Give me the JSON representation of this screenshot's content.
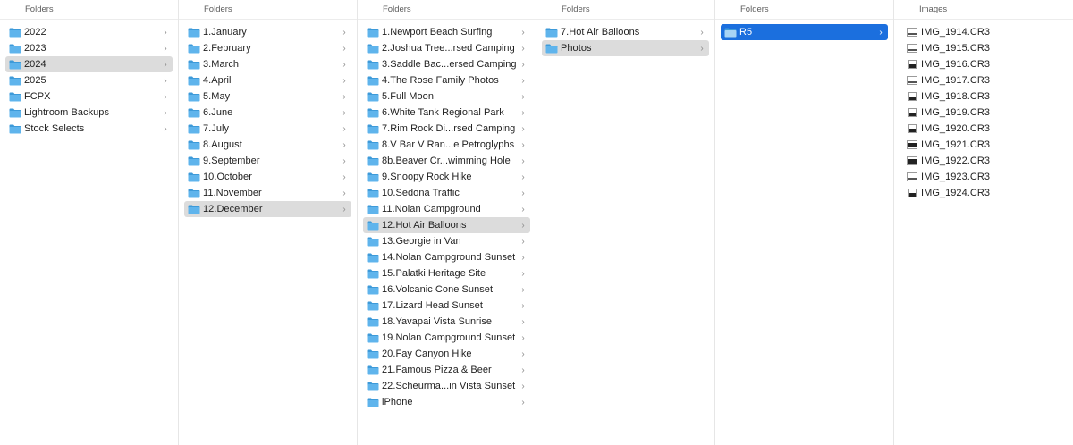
{
  "columns": [
    {
      "header": "Folders",
      "items": [
        {
          "label": "2022",
          "sel": ""
        },
        {
          "label": "2023",
          "sel": ""
        },
        {
          "label": "2024",
          "sel": "gray"
        },
        {
          "label": "2025",
          "sel": ""
        },
        {
          "label": "FCPX",
          "sel": ""
        },
        {
          "label": "Lightroom Backups",
          "sel": ""
        },
        {
          "label": "Stock Selects",
          "sel": ""
        }
      ]
    },
    {
      "header": "Folders",
      "items": [
        {
          "label": "1.January",
          "sel": ""
        },
        {
          "label": "2.February",
          "sel": ""
        },
        {
          "label": "3.March",
          "sel": ""
        },
        {
          "label": "4.April",
          "sel": ""
        },
        {
          "label": "5.May",
          "sel": ""
        },
        {
          "label": "6.June",
          "sel": ""
        },
        {
          "label": "7.July",
          "sel": ""
        },
        {
          "label": "8.August",
          "sel": ""
        },
        {
          "label": "9.September",
          "sel": ""
        },
        {
          "label": "10.October",
          "sel": ""
        },
        {
          "label": "11.November",
          "sel": ""
        },
        {
          "label": "12.December",
          "sel": "gray"
        }
      ]
    },
    {
      "header": "Folders",
      "items": [
        {
          "label": "1.Newport Beach Surfing",
          "sel": ""
        },
        {
          "label": "2.Joshua Tree...rsed Camping",
          "sel": ""
        },
        {
          "label": "3.Saddle Bac...ersed Camping",
          "sel": ""
        },
        {
          "label": "4.The Rose Family Photos",
          "sel": ""
        },
        {
          "label": "5.Full Moon",
          "sel": ""
        },
        {
          "label": "6.White Tank Regional Park",
          "sel": ""
        },
        {
          "label": "7.Rim Rock Di...rsed Camping",
          "sel": ""
        },
        {
          "label": "8.V Bar V Ran...e Petroglyphs",
          "sel": ""
        },
        {
          "label": "8b.Beaver Cr...wimming Hole",
          "sel": ""
        },
        {
          "label": "9.Snoopy Rock Hike",
          "sel": ""
        },
        {
          "label": "10.Sedona Traffic",
          "sel": ""
        },
        {
          "label": "11.Nolan Campground",
          "sel": ""
        },
        {
          "label": "12.Hot Air Balloons",
          "sel": "gray"
        },
        {
          "label": "13.Georgie in Van",
          "sel": ""
        },
        {
          "label": "14.Nolan Campground Sunset",
          "sel": ""
        },
        {
          "label": "15.Palatki Heritage Site",
          "sel": ""
        },
        {
          "label": "16.Volcanic Cone Sunset",
          "sel": ""
        },
        {
          "label": "17.Lizard Head Sunset",
          "sel": ""
        },
        {
          "label": "18.Yavapai Vista Sunrise",
          "sel": ""
        },
        {
          "label": "19.Nolan Campground Sunset",
          "sel": ""
        },
        {
          "label": "20.Fay Canyon Hike",
          "sel": ""
        },
        {
          "label": "21.Famous Pizza & Beer",
          "sel": ""
        },
        {
          "label": "22.Scheurma...in Vista Sunset",
          "sel": ""
        },
        {
          "label": "iPhone",
          "sel": ""
        }
      ]
    },
    {
      "header": "Folders",
      "items": [
        {
          "label": "7.Hot Air Balloons",
          "sel": ""
        },
        {
          "label": "Photos",
          "sel": "gray"
        }
      ]
    },
    {
      "header": "Folders",
      "items": [
        {
          "label": "R5",
          "sel": "blue"
        }
      ]
    }
  ],
  "images_column": {
    "header": "Images",
    "items": [
      {
        "label": "IMG_1914.CR3",
        "thumb": "landscape"
      },
      {
        "label": "IMG_1915.CR3",
        "thumb": "landscape"
      },
      {
        "label": "IMG_1916.CR3",
        "thumb": "portrait"
      },
      {
        "label": "IMG_1917.CR3",
        "thumb": "landscape"
      },
      {
        "label": "IMG_1918.CR3",
        "thumb": "portrait"
      },
      {
        "label": "IMG_1919.CR3",
        "thumb": "portrait"
      },
      {
        "label": "IMG_1920.CR3",
        "thumb": "portrait"
      },
      {
        "label": "IMG_1921.CR3",
        "thumb": "dark"
      },
      {
        "label": "IMG_1922.CR3",
        "thumb": "dark"
      },
      {
        "label": "IMG_1923.CR3",
        "thumb": "landscape"
      },
      {
        "label": "IMG_1924.CR3",
        "thumb": "portrait"
      }
    ]
  },
  "colors": {
    "selection_blue": "#1b6fde",
    "selection_gray": "#dcdcdc",
    "folder_blue": "#5fb4ec"
  },
  "icons": {
    "folder": "folder-icon",
    "chevron": "chevron-right-icon",
    "image": "image-thumbnail-icon"
  }
}
